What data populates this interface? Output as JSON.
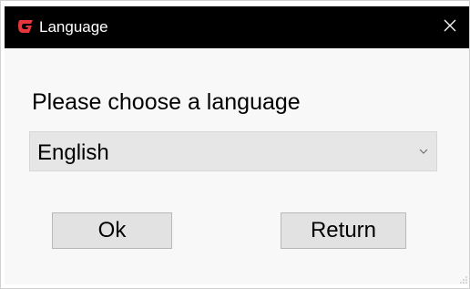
{
  "window": {
    "title": "Language",
    "icon": "app-logo-icon",
    "close_icon": "close-icon"
  },
  "dialog": {
    "prompt": "Please choose a language",
    "language_select": {
      "selected": "English",
      "icon": "chevron-down-icon"
    },
    "buttons": {
      "ok_label": "Ok",
      "return_label": "Return"
    }
  },
  "colors": {
    "titlebar_bg": "#000000",
    "titlebar_text": "#ffffff",
    "logo_red": "#e8343a",
    "content_bg": "#f8f8f8",
    "select_bg": "#e6e6e6",
    "button_bg": "#e2e2e2"
  }
}
